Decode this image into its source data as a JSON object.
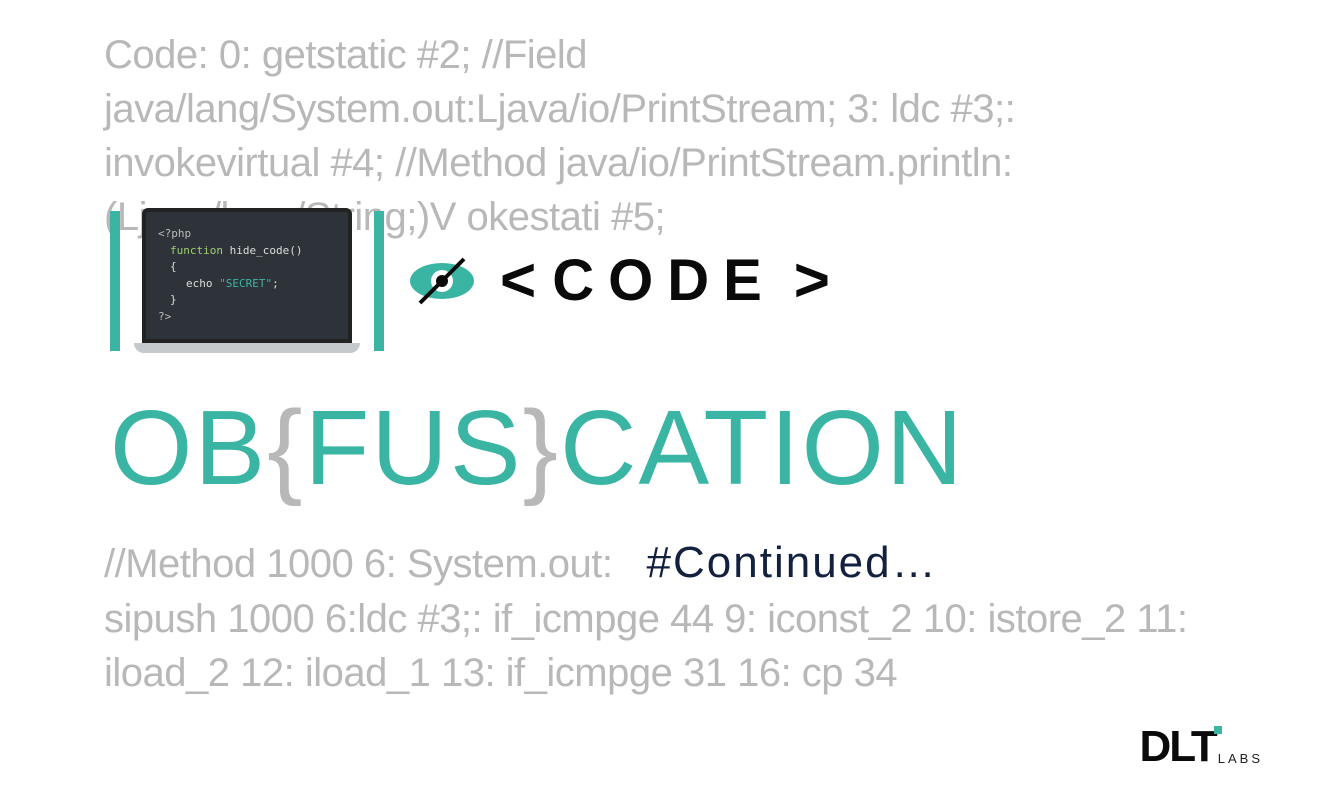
{
  "bg_top": "Code: 0: getstatic #2; //Field java/lang/System.out:Ljava/io/PrintStream; 3: ldc #3;: invokevirtual #4; //Method java/io/PrintStream.println:(Ljava/lang/String;)V okestati #5;",
  "laptop_code": {
    "l1": "<?php",
    "l2a": "function",
    "l2b": " hide_code()",
    "l3": "{",
    "l4a": "echo ",
    "l4b": "\"SECRET\"",
    "l4c": ";",
    "l5": "}",
    "l6": "?>"
  },
  "code_tag": {
    "left": "<",
    "word": "CODE",
    "right": ">"
  },
  "title": {
    "p1": "OB",
    "b1": "{",
    "p2": "FUS",
    "b2": "}",
    "p3": "CATION"
  },
  "bottom": {
    "gray1": "//Method 1000 6: System.out:",
    "continued": "#Continued…",
    "gray2": "sipush 1000 6:ldc #3;: if_icmpge 44 9: iconst_2 10: istore_2 11: iload_2 12: iload_1 13: if_icmpge 31 16: cp 34"
  },
  "logo": {
    "main": "DLT",
    "sub": "LABS"
  }
}
